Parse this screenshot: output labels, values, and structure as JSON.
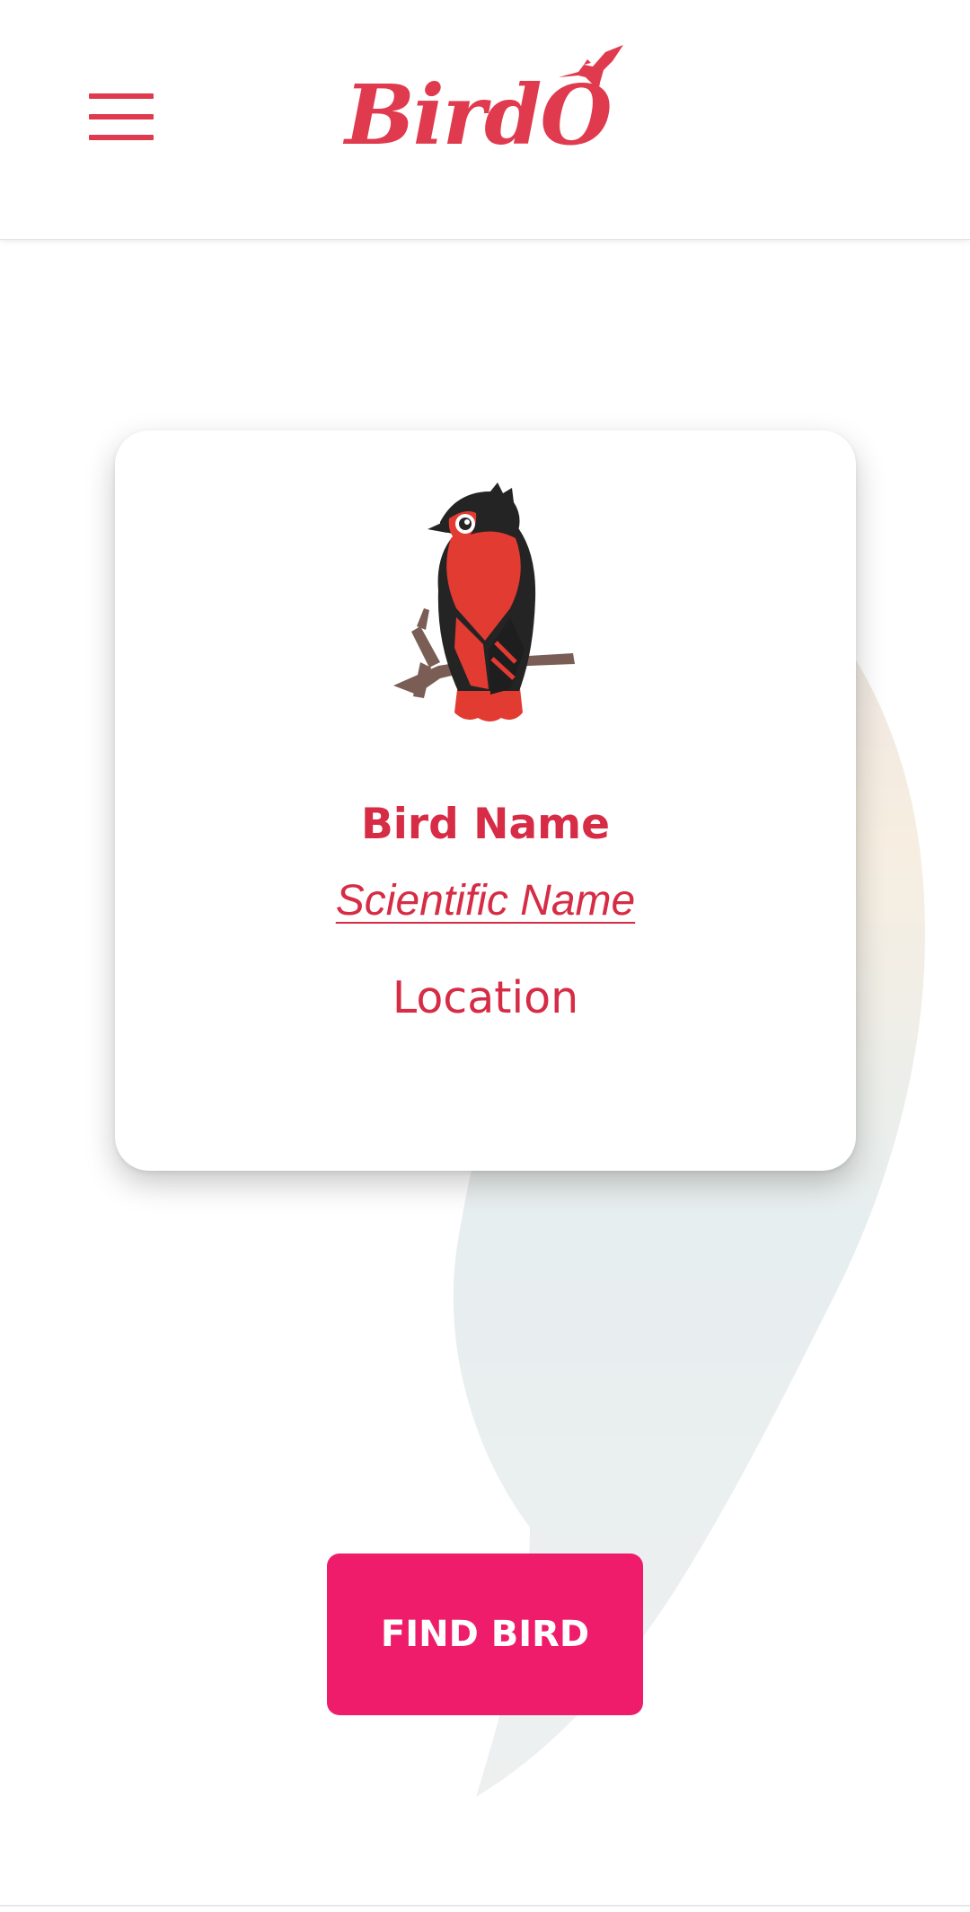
{
  "app": {
    "logo_text": "BirdO"
  },
  "header": {
    "menu_icon": "hamburger-menu-icon"
  },
  "card": {
    "bird_name": "Bird Name",
    "scientific_name": "Scientific Name ",
    "location": "Location"
  },
  "actions": {
    "find_bird_label": "FIND BIRD"
  },
  "colors": {
    "brand_red": "#e03a4e",
    "text_red": "#d62c45",
    "button_pink": "#ef1c6b"
  }
}
